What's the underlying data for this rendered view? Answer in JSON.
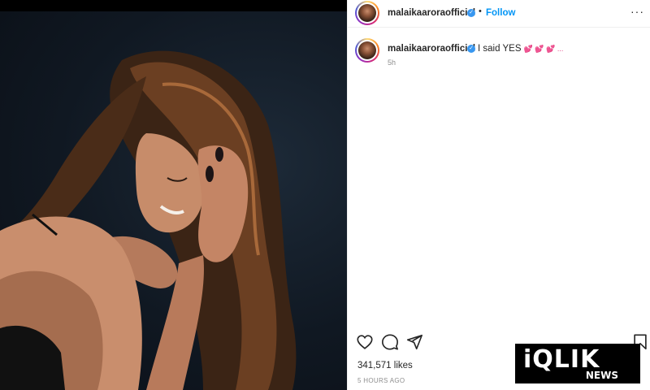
{
  "post": {
    "username": "malaikaaroraofficial",
    "follow_label": "Follow",
    "separator": "•",
    "more_label": "···",
    "verified_glyph": "✓",
    "caption_text": "I said YES",
    "caption_hearts": "💕 💕 💕 ...",
    "caption_time": "5h",
    "likes": "341,571 likes",
    "timestamp": "5 HOURS AGO"
  },
  "actions": {
    "like_icon": "heart-icon",
    "comment_icon": "comment-icon",
    "share_icon": "share-icon",
    "save_icon": "bookmark-icon"
  },
  "watermark": {
    "main": "iQLIK",
    "sub": "NEWS"
  },
  "colors": {
    "accent": "#0095f6",
    "verified": "#3897f0",
    "secondary_text": "#8e8e8e"
  }
}
